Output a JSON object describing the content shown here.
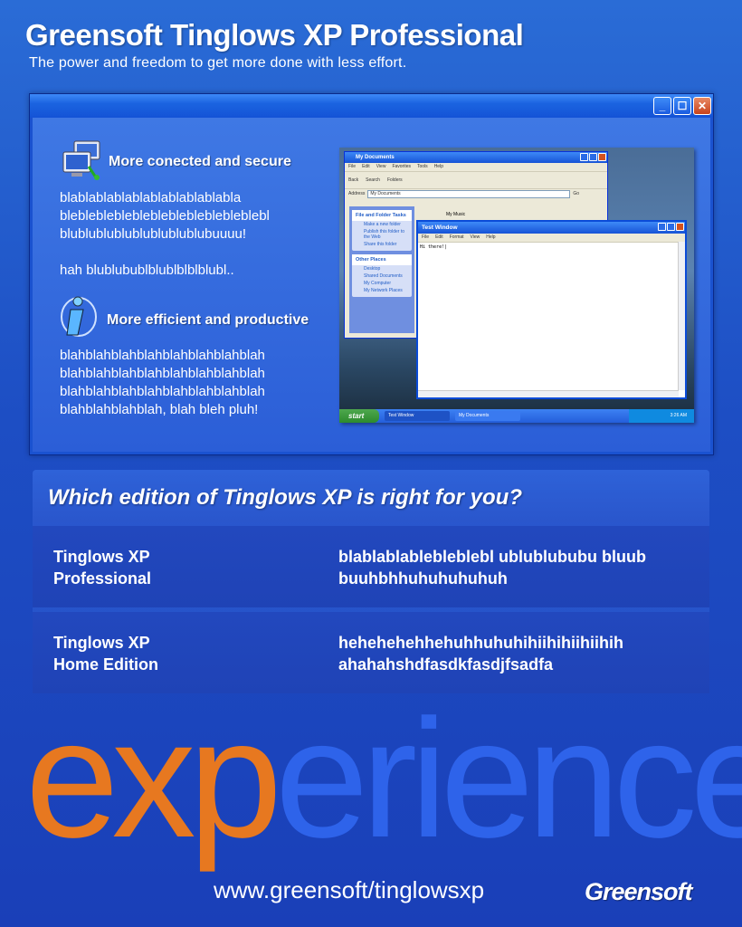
{
  "header": {
    "title": "Greensoft Tinglows XP Professional",
    "subtitle": "The power and freedom to get more done with less effort."
  },
  "window": {
    "buttons": {
      "minimize": "_",
      "maximize": "☐",
      "close": "✕"
    },
    "features": [
      {
        "icon": "network-computers-icon",
        "heading": "More conected and secure",
        "text": "blablablablablablablablablabla\nblebleblebleblebleblebleblebleblebl\nblublublublublublublublubuuuu!\n\nhah blublubublblublblblblubl.."
      },
      {
        "icon": "info-icon",
        "heading": "More efficient and productive",
        "text": "blahblahblahblahblahblahblahblah\nblahblahblahblahblahblahblahblah\nblahblahblahblahblahblahblahblah\nblahblahblahblah, blah bleh pluh!"
      }
    ],
    "screenshot": {
      "mydocs_title": "My Documents",
      "menu": [
        "File",
        "Edit",
        "View",
        "Favorites",
        "Tools",
        "Help"
      ],
      "toolbar": [
        "Back",
        "Search",
        "Folders"
      ],
      "address_label": "Address",
      "address_value": "My Documents",
      "go_label": "Go",
      "tasks_header": "File and Folder Tasks",
      "tasks": [
        "Make a new folder",
        "Publish this folder to the Web",
        "Share this folder"
      ],
      "places_header": "Other Places",
      "places": [
        "Desktop",
        "Shared Documents",
        "My Computer",
        "My Network Places"
      ],
      "mymusic": "My Music",
      "test_title": "Test Window",
      "test_menu": [
        "File",
        "Edit",
        "Format",
        "View",
        "Help"
      ],
      "test_text": "Hi there!|",
      "start_label": "start",
      "taskbar_items": [
        "Test Window",
        "My Documents"
      ],
      "clock": "3:26 AM"
    }
  },
  "editions": {
    "heading": "Which edition of Tinglows XP is right for you?",
    "rows": [
      {
        "name": "Tinglows XP\nProfessional",
        "desc": "blablablablebleblebl ublublububu bluub\nbuuhbhhuhuhuhuhuh"
      },
      {
        "name": "Tinglows XP\nHome Edition",
        "desc": "hehehehehhehuhhuhuhihiihihiihiihih\nahahahshdfasdkfasdjfsadfa"
      }
    ]
  },
  "brand_word": {
    "part1": "exp",
    "part2": "erience"
  },
  "footer": {
    "url": "www.greensoft/tinglowsxp",
    "brand": "Greensoft"
  },
  "colors": {
    "accent_orange": "#e77820",
    "accent_blue": "#2e63ea"
  }
}
